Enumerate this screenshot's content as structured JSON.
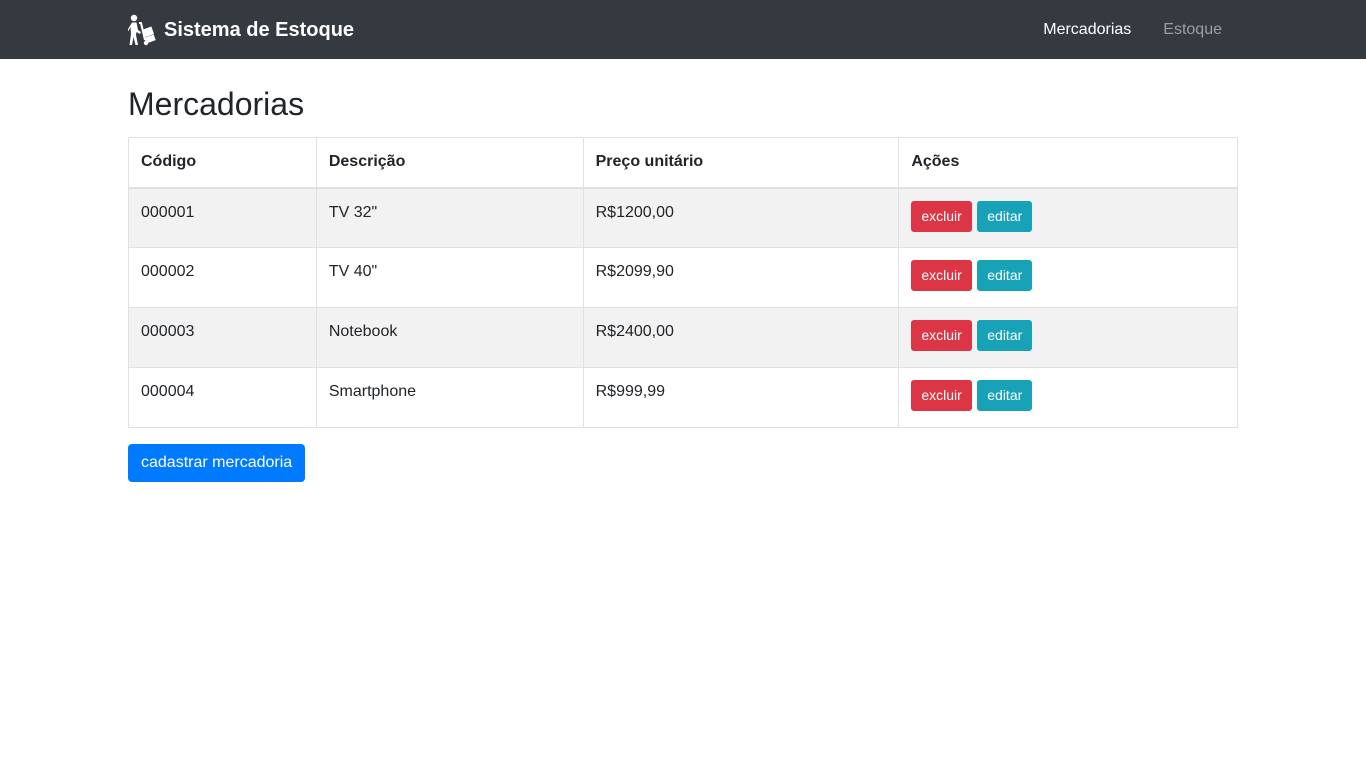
{
  "navbar": {
    "brand_text": "Sistema de Estoque",
    "brand_icon": "hand-truck-icon",
    "links": [
      {
        "label": "Mercadorias",
        "active": true
      },
      {
        "label": "Estoque",
        "active": false
      }
    ],
    "background_color": "#343a40"
  },
  "main": {
    "title": "Mercadorias",
    "table": {
      "headers": [
        "Código",
        "Descrição",
        "Preço unitário",
        "Ações"
      ],
      "rows": [
        {
          "codigo": "000001",
          "descricao": "TV 32\"",
          "preco": "R$1200,00"
        },
        {
          "codigo": "000002",
          "descricao": "TV 40\"",
          "preco": "R$2099,90"
        },
        {
          "codigo": "000003",
          "descricao": "Notebook",
          "preco": "R$2400,00"
        },
        {
          "codigo": "000004",
          "descricao": "Smartphone",
          "preco": "R$999,99"
        }
      ],
      "action_labels": {
        "delete": "excluir",
        "edit": "editar"
      }
    },
    "add_button_label": "cadastrar mercadoria"
  },
  "colors": {
    "danger": "#dc3545",
    "info": "#17a2b8",
    "primary": "#007bff"
  }
}
